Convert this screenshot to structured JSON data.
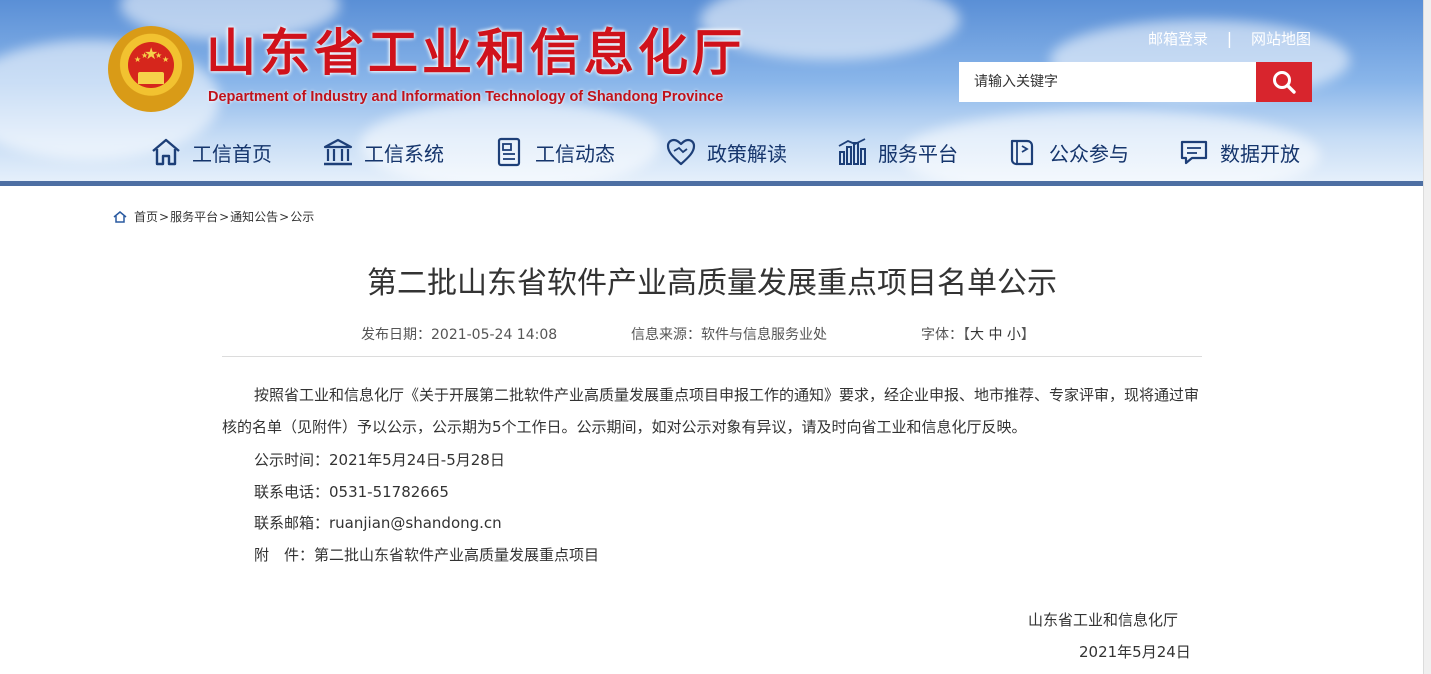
{
  "header": {
    "title_cn": "山东省工业和信息化厅",
    "title_en": "Department of Industry and Information Technology of Shandong Province",
    "top_links": [
      "邮箱登录",
      "网站地图"
    ],
    "top_links_separator": "|",
    "search": {
      "placeholder": "请输入关键字",
      "button_icon": "search-icon"
    },
    "nav": [
      {
        "label": "工信首页",
        "icon": "home-icon"
      },
      {
        "label": "工信系统",
        "icon": "building-icon"
      },
      {
        "label": "工信动态",
        "icon": "document-icon"
      },
      {
        "label": "政策解读",
        "icon": "handshake-heart-icon"
      },
      {
        "label": "服务平台",
        "icon": "bar-chart-icon"
      },
      {
        "label": "公众参与",
        "icon": "book-icon"
      },
      {
        "label": "数据开放",
        "icon": "chat-icon"
      }
    ],
    "colors": {
      "title": "#d0121b",
      "search_button": "#d8252d",
      "nav_text": "#15356c",
      "band": "#4d6fa3"
    }
  },
  "breadcrumb": {
    "icon": "home-icon",
    "items": [
      "首页",
      "服务平台",
      "通知公告",
      "公示"
    ],
    "separator": ">"
  },
  "article": {
    "title": "第二批山东省软件产业高质量发展重点项目名单公示",
    "meta": {
      "date_label": "发布日期：",
      "date": "2021-05-24 14:08",
      "source_label": "信息来源：",
      "source": "软件与信息服务业处",
      "font_label": "字体：",
      "font_open": "【",
      "font_sizes": [
        "大",
        "中",
        "小"
      ],
      "font_close": "】"
    },
    "body_paragraph": "按照省工业和信息化厅《关于开展第二批软件产业高质量发展重点项目申报工作的通知》要求，经企业申报、地市推荐、专家评审，现将通过审核的名单（见附件）予以公示，公示期为5个工作日。公示期间，如对公示对象有异议，请及时向省工业和信息化厅反映。",
    "lines": [
      "公示时间：2021年5月24日-5月28日",
      "联系电话：0531-51782665",
      "联系邮箱：ruanjian@shandong.cn",
      "附　件：第二批山东省软件产业高质量发展重点项目"
    ],
    "signature": {
      "org": "山东省工业和信息化厅",
      "date": "2021年5月24日"
    }
  }
}
